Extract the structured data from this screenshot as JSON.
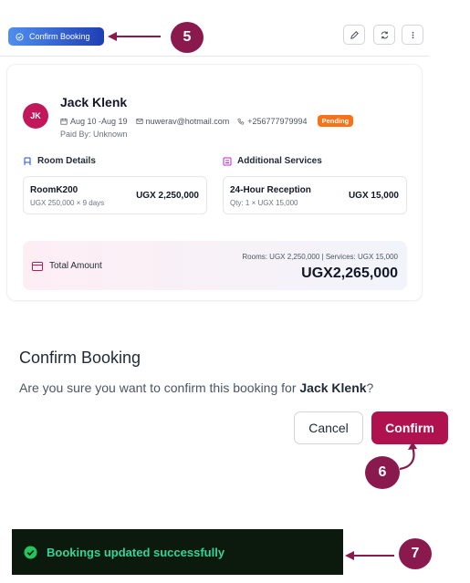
{
  "panel1": {
    "confirm_booking_label": "Confirm Booking",
    "step_badge": "5",
    "guest": {
      "initials": "JK",
      "name": "Jack Klenk",
      "dates": "Aug 10 -Aug 19",
      "email": "nuwerav@hotmail.com",
      "phone": "+256777979994",
      "status": "Pending",
      "paid_by": "Paid By: Unknown"
    },
    "room_details": {
      "title": "Room Details",
      "room_name": "RoomK200",
      "room_rate": "UGX 250,000 × 9 days",
      "room_price": "UGX 2,250,000"
    },
    "additional_services": {
      "title": "Additional Services",
      "service_name": "24-Hour Reception",
      "service_qty": "Qty: 1 × UGX 15,000",
      "service_price": "UGX 15,000"
    },
    "total": {
      "label": "Total Amount",
      "breakdown": "Rooms: UGX 2,250,000 | Services: UGX 15,000",
      "amount": "UGX2,265,000"
    },
    "colors": {
      "status_pending": "#f97316",
      "avatar": "#c2185b",
      "step_badge": "#8a1a4e"
    }
  },
  "panel2": {
    "title": "Confirm Booking",
    "message_prefix": "Are you sure you want to confirm this booking for ",
    "message_name": "Jack Klenk",
    "message_suffix": "?",
    "cancel_label": "Cancel",
    "confirm_label": "Confirm",
    "step_badge": "6",
    "colors": {
      "confirm_button": "#b0124f"
    }
  },
  "panel3": {
    "toast_message": "Bookings updated successfully",
    "step_badge": "7",
    "colors": {
      "toast_bg": "#0b1a0d",
      "toast_text": "#34d399"
    }
  }
}
